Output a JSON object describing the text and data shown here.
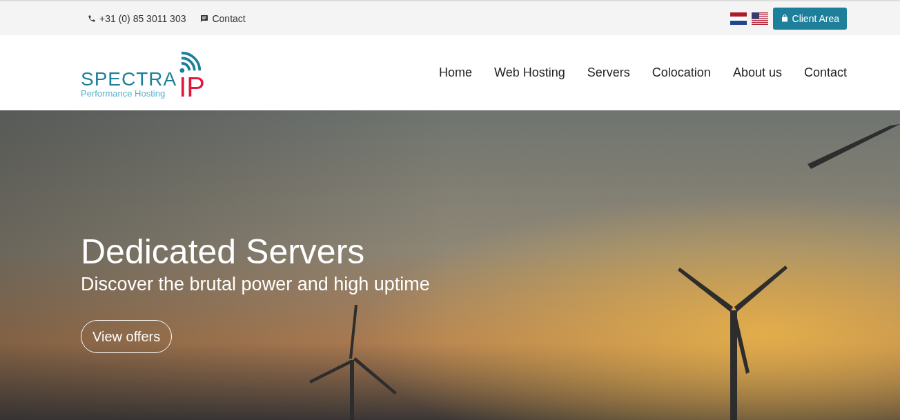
{
  "top_bar": {
    "phone": "+31 (0) 85 3011 303",
    "contact": "Contact",
    "client_area": "Client Area"
  },
  "logo": {
    "name": "SPECTRA",
    "suffix": "IP",
    "tagline": "Performance Hosting"
  },
  "nav": [
    {
      "label": "Home"
    },
    {
      "label": "Web Hosting"
    },
    {
      "label": "Servers"
    },
    {
      "label": "Colocation"
    },
    {
      "label": "About us"
    },
    {
      "label": "Contact"
    }
  ],
  "hero": {
    "kind": "picture",
    "title": "Dedicated Servers",
    "subtitle": "Discover the brutal power and high uptime",
    "button": "View offers"
  }
}
